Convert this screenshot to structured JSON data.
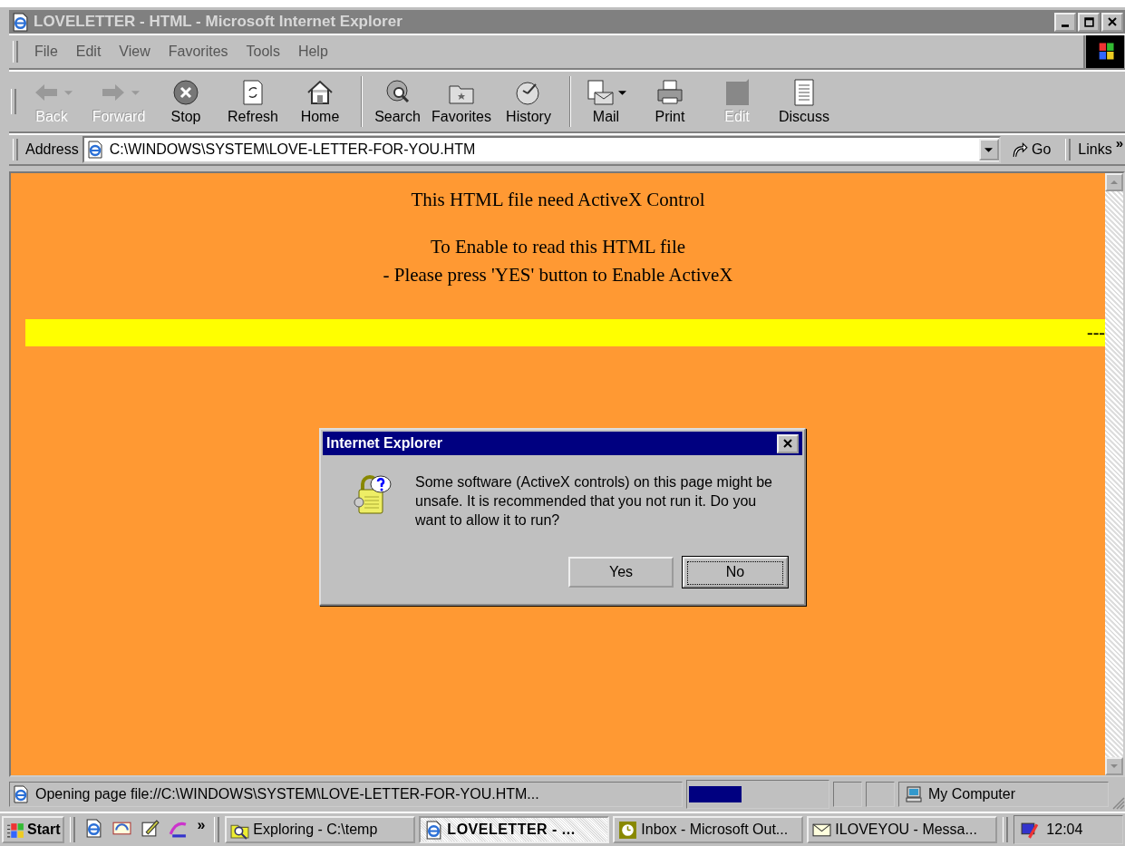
{
  "window": {
    "title": "LOVELETTER - HTML - Microsoft Internet Explorer"
  },
  "menu": [
    "File",
    "Edit",
    "View",
    "Favorites",
    "Tools",
    "Help"
  ],
  "toolbar": [
    {
      "kind": "back",
      "label": "Back",
      "disabled": true,
      "has_menu": true,
      "separator_before": false
    },
    {
      "kind": "forward",
      "label": "Forward",
      "disabled": true,
      "has_menu": true,
      "separator_before": false
    },
    {
      "kind": "stop",
      "label": "Stop",
      "disabled": false,
      "has_menu": false,
      "separator_before": false
    },
    {
      "kind": "refresh",
      "label": "Refresh",
      "disabled": false,
      "has_menu": false,
      "separator_before": false
    },
    {
      "kind": "home",
      "label": "Home",
      "disabled": false,
      "has_menu": false,
      "separator_before": false
    },
    {
      "kind": "search",
      "label": "Search",
      "disabled": false,
      "has_menu": false,
      "separator_before": true
    },
    {
      "kind": "favorites",
      "label": "Favorites",
      "disabled": false,
      "has_menu": false,
      "separator_before": false
    },
    {
      "kind": "history",
      "label": "History",
      "disabled": false,
      "has_menu": false,
      "separator_before": false
    },
    {
      "kind": "mail",
      "label": "Mail",
      "disabled": false,
      "has_menu": true,
      "separator_before": true
    },
    {
      "kind": "print",
      "label": "Print",
      "disabled": false,
      "has_menu": false,
      "separator_before": false
    },
    {
      "kind": "edit",
      "label": "Edit",
      "disabled": true,
      "has_menu": false,
      "separator_before": false
    },
    {
      "kind": "discuss",
      "label": "Discuss",
      "disabled": false,
      "has_menu": false,
      "separator_before": false
    }
  ],
  "address_bar": {
    "label": "Address",
    "value": "C:\\WINDOWS\\SYSTEM\\LOVE-LETTER-FOR-YOU.HTM",
    "go": "Go",
    "links": "Links",
    "more": "»"
  },
  "page": {
    "paragraphs": [
      [
        "This HTML file need ActiveX Control"
      ],
      [
        "To Enable to read this HTML file",
        "- Please press 'YES' button to Enable ActiveX"
      ]
    ],
    "banner_text": "---"
  },
  "dialog": {
    "title": "Internet Explorer",
    "message": "Some software (ActiveX controls) on this page might be unsafe. It is recommended that you not run it. Do you want to allow it to run?",
    "buttons": [
      {
        "label": "Yes",
        "default": false
      },
      {
        "label": "No",
        "default": true
      }
    ]
  },
  "status_bar": {
    "text": "Opening page file://C:\\WINDOWS\\SYSTEM\\LOVE-LETTER-FOR-YOU.HTM...",
    "level": 0.38,
    "zone": "My Computer"
  },
  "taskbar": {
    "start": "Start",
    "quick_launch": [
      {
        "kind": "browser"
      },
      {
        "kind": "mail"
      },
      {
        "kind": "edit"
      },
      {
        "kind": "channels"
      }
    ],
    "more": "»",
    "tasks": [
      {
        "kind": "explorer",
        "label": "Exploring - C:\\temp",
        "selected": false
      },
      {
        "kind": "browser",
        "label": "LOVELETTER - ...",
        "selected": true
      },
      {
        "kind": "outlook",
        "label": "Inbox - Microsoft Out...",
        "selected": false
      },
      {
        "kind": "message",
        "label": "ILOVEYOU - Messa...",
        "selected": false
      }
    ],
    "clock": "12:04"
  }
}
